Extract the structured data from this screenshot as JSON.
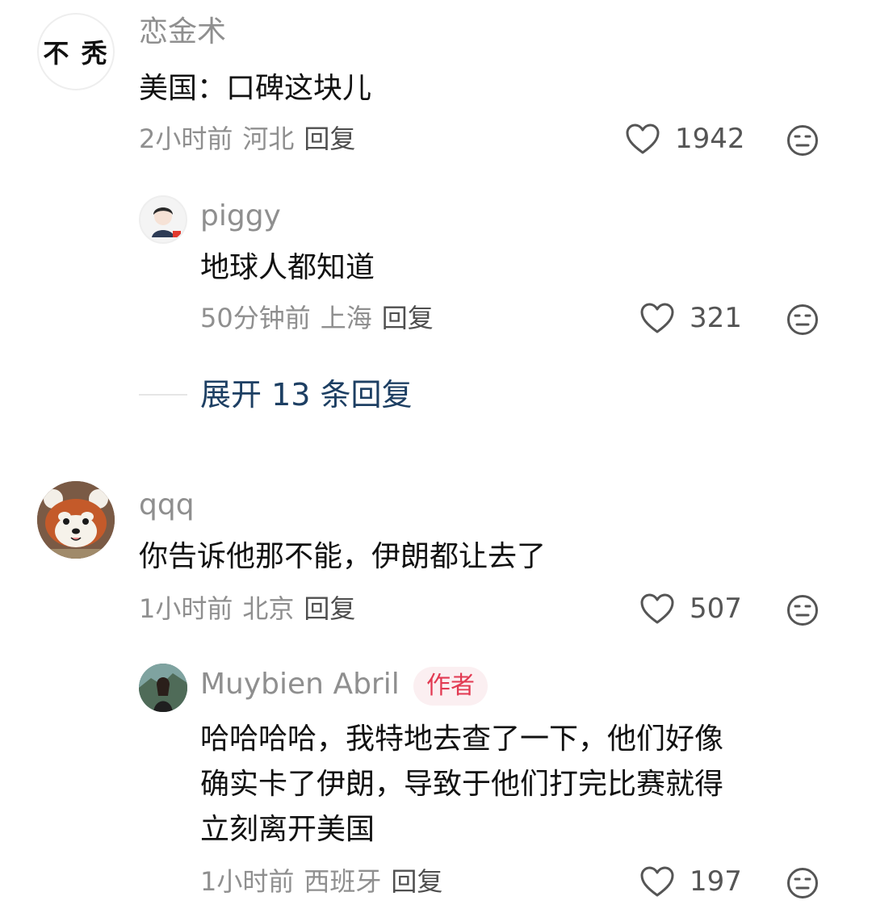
{
  "comments": [
    {
      "avatar_text": "不 秃",
      "username": "恋金术",
      "content": "美国：口碑这块儿",
      "time": "2小时前",
      "location": "河北",
      "reply_label": "回复",
      "likes": "1942",
      "reply": {
        "username": "piggy",
        "content": "地球人都知道",
        "time": "50分钟前",
        "location": "上海",
        "reply_label": "回复",
        "likes": "321"
      },
      "expand_label": "展开 13 条回复"
    },
    {
      "username": "qqq",
      "content": "你告诉他那不能，伊朗都让去了",
      "time": "1小时前",
      "location": "北京",
      "reply_label": "回复",
      "likes": "507",
      "reply": {
        "username": "Muybien Abril",
        "badge": "作者",
        "content_lines": [
          "哈哈哈哈，我特地去查了一下，他们好像",
          "确实卡了伊朗，导致于他们打完比赛就得",
          "立刻离开美国"
        ],
        "time": "1小时前",
        "location": "西班牙",
        "reply_label": "回复",
        "likes": "197"
      }
    }
  ],
  "icons": {
    "like": "heart-outline-icon",
    "dislike": "meh-face-icon"
  },
  "colors": {
    "muted_text": "#8f8f8f",
    "expand_link": "#1d3f63",
    "author_badge_bg": "#fbeff1",
    "author_badge_text": "#e23a52"
  }
}
